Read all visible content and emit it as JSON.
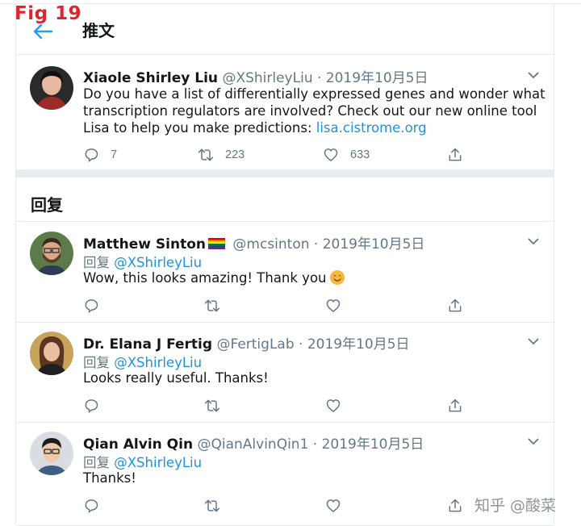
{
  "figure_label": "Fig 19",
  "header": {
    "title": "推文"
  },
  "main_tweet": {
    "author_name": "Xiaole Shirley Liu",
    "handle_date": "@XShirleyLiu · 2019年10月5日",
    "lines": [
      "Do you have a list of differentially expressed genes and wonder what",
      "transcription regulators are involved? Check out our new online tool"
    ],
    "line3_prefix": "Lisa to help you make predictions: ",
    "link": "lisa.cistrome.org",
    "reply_count": "7",
    "retweet_count": "223",
    "like_count": "633"
  },
  "replies_section": {
    "title": "回复"
  },
  "replies": [
    {
      "author_name": "Matthew Sinton",
      "handle_date": "@mcsinton · 2019年10月5日",
      "reply_prefix": "回复 ",
      "reply_to": "@XShirleyLiu",
      "text": "Wow, this looks amazing! Thank you"
    },
    {
      "author_name": "Dr. Elana J Fertig",
      "handle_date": "@FertigLab · 2019年10月5日",
      "reply_prefix": "回复 ",
      "reply_to": "@XShirleyLiu",
      "text": "Looks really useful. Thanks!"
    },
    {
      "author_name": "Qian Alvin Qin",
      "handle_date": "@QianAlvinQin1 · 2019年10月5日",
      "reply_prefix": "回复 ",
      "reply_to": "@XShirleyLiu",
      "text": "Thanks!"
    }
  ],
  "watermark": "知乎 @酸菜",
  "colors": {
    "link": "#1b95e0",
    "muted": "#657786",
    "divider": "#e6ecf0"
  }
}
